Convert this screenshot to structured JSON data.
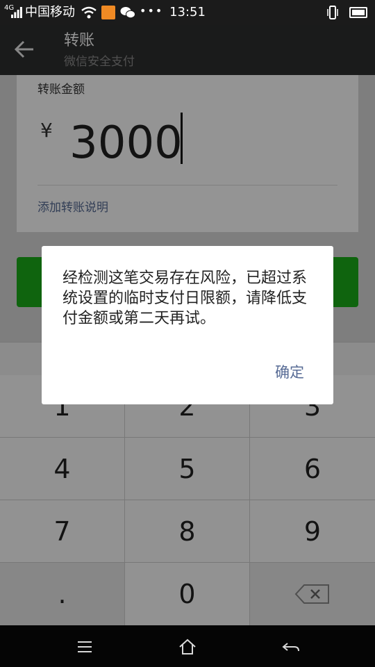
{
  "status_bar": {
    "network": "4G",
    "carrier": "中国移动",
    "time": "13:51",
    "icons": [
      "signal-icon",
      "wifi-icon",
      "app-notification-icon",
      "wechat-icon",
      "more-dots-icon",
      "phone-vibrate-icon",
      "battery-icon"
    ]
  },
  "header": {
    "title": "转账",
    "subtitle": "微信安全支付"
  },
  "transfer": {
    "amount_label": "转账金额",
    "currency_symbol": "¥",
    "amount_value": "3000",
    "add_note_link": "添加转账说明"
  },
  "keypad": {
    "keys": [
      "1",
      "2",
      "3",
      "4",
      "5",
      "6",
      "7",
      "8",
      "9",
      ".",
      "0"
    ]
  },
  "dialog": {
    "message": "经检测这笔交易存在风险，已超过系统设置的临时支付日限额，请降低支付金额或第二天再试。",
    "confirm_label": "确定"
  },
  "colors": {
    "primary_green": "#1aad19",
    "link_blue": "#576b95",
    "top_bar": "#2e2f30"
  }
}
